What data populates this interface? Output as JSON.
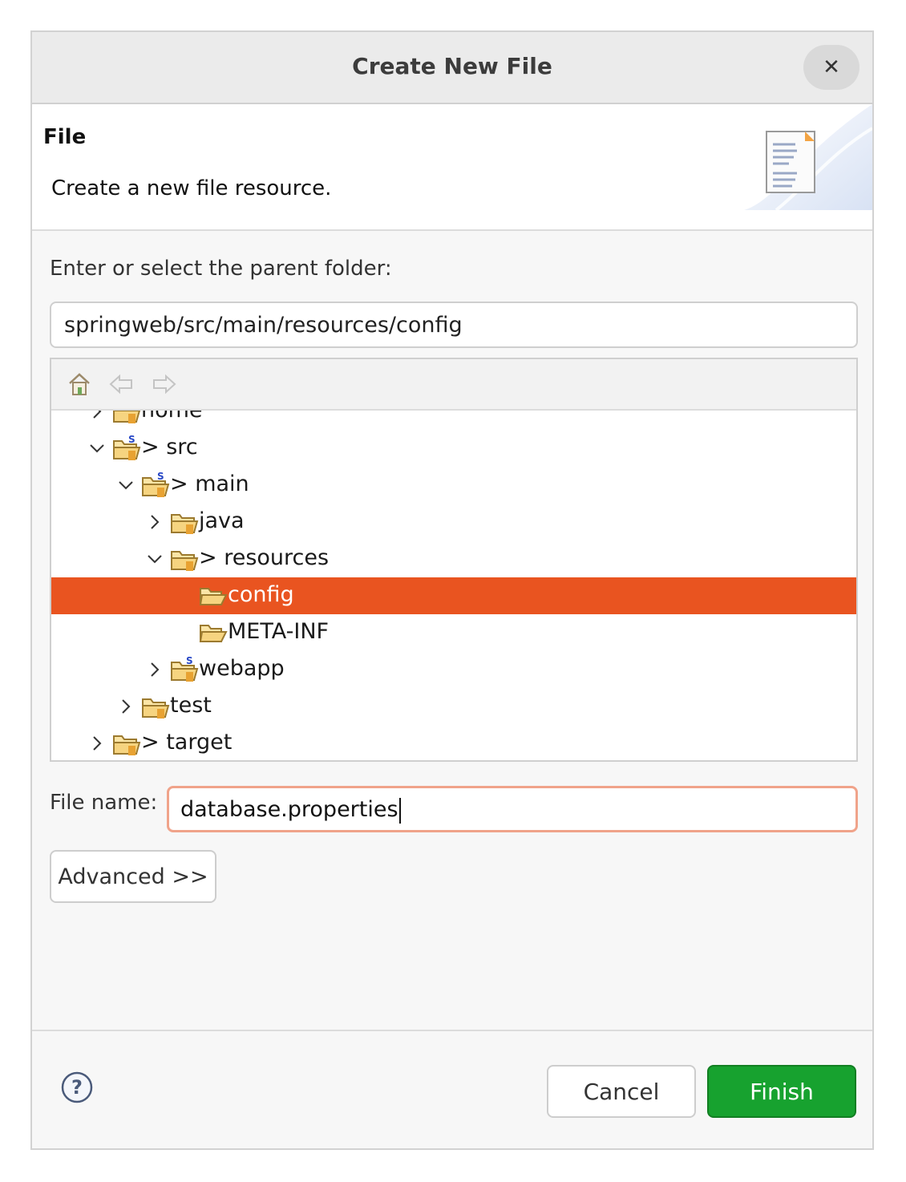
{
  "dialog": {
    "title": "Create New File",
    "close_icon": "close-icon",
    "banner": {
      "title": "File",
      "description": "Create a new file resource.",
      "icon": "new-file-wizard-icon"
    },
    "parent_folder": {
      "label": "Enter or select the parent folder:",
      "value": "springweb/src/main/resources/config"
    },
    "tree_toolbar": {
      "icons": [
        "home-icon",
        "back-arrow-icon",
        "forward-arrow-icon"
      ]
    },
    "tree": {
      "items": [
        {
          "label": "home",
          "expanded": false
        },
        {
          "label": "> src",
          "expanded": true
        },
        {
          "label": "> main",
          "expanded": true
        },
        {
          "label": "java",
          "expanded": false
        },
        {
          "label": "> resources",
          "expanded": true
        },
        {
          "label": "config",
          "selected": true
        },
        {
          "label": "META-INF"
        },
        {
          "label": "webapp",
          "expanded": false
        },
        {
          "label": "test",
          "expanded": false
        },
        {
          "label": "> target",
          "expanded": false
        }
      ]
    },
    "file_name": {
      "label": "File name:",
      "value": "database.properties"
    },
    "advanced_label": "Advanced >>",
    "help_icon": "help-icon",
    "cancel_label": "Cancel",
    "finish_label": "Finish",
    "colors": {
      "selection": "#e95420",
      "finish": "#17a22f",
      "focus_border": "#f0a38a"
    }
  }
}
